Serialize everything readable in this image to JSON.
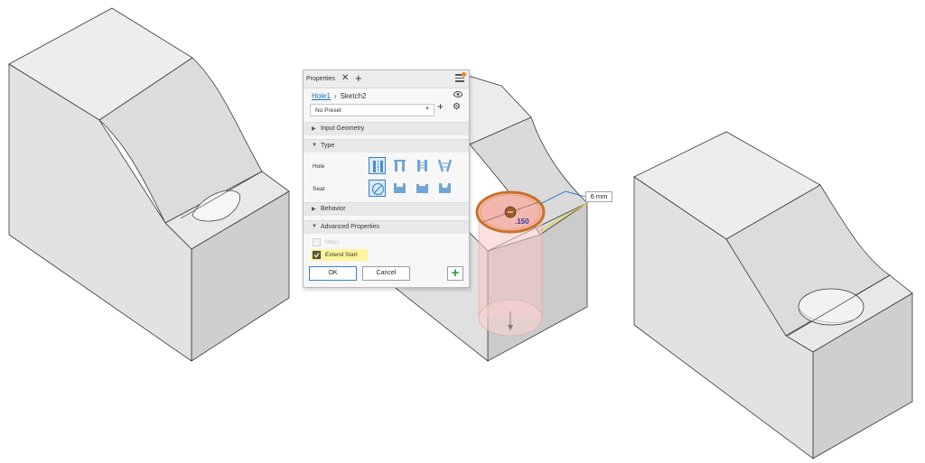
{
  "properties_panel": {
    "tab_title": "Properties",
    "breadcrumb": {
      "feature": "Hole1",
      "sketch": "Sketch2"
    },
    "preset": {
      "value": "No Preset"
    },
    "sections": {
      "input_geometry": "Input Geometry",
      "type": "Type",
      "behavior": "Behavior",
      "advanced_properties": "Advanced Properties"
    },
    "type_rows": {
      "hole_label": "Hole",
      "seat_label": "Seat"
    },
    "advanced": {
      "option_dimmed": "Mass",
      "extend_start": "Extend Start",
      "extend_start_checked": true
    },
    "buttons": {
      "ok": "OK",
      "cancel": "Cancel"
    }
  },
  "viewport": {
    "diameter_label": "6 mm",
    "depth_value": ".150"
  },
  "colors": {
    "accent_blue": "#1a6fc2",
    "highlight_yellow": "#fff49a",
    "apply_green": "#2b9a3e",
    "hole_orange": "#c8722b",
    "part_gray": "#e3e3e3"
  }
}
